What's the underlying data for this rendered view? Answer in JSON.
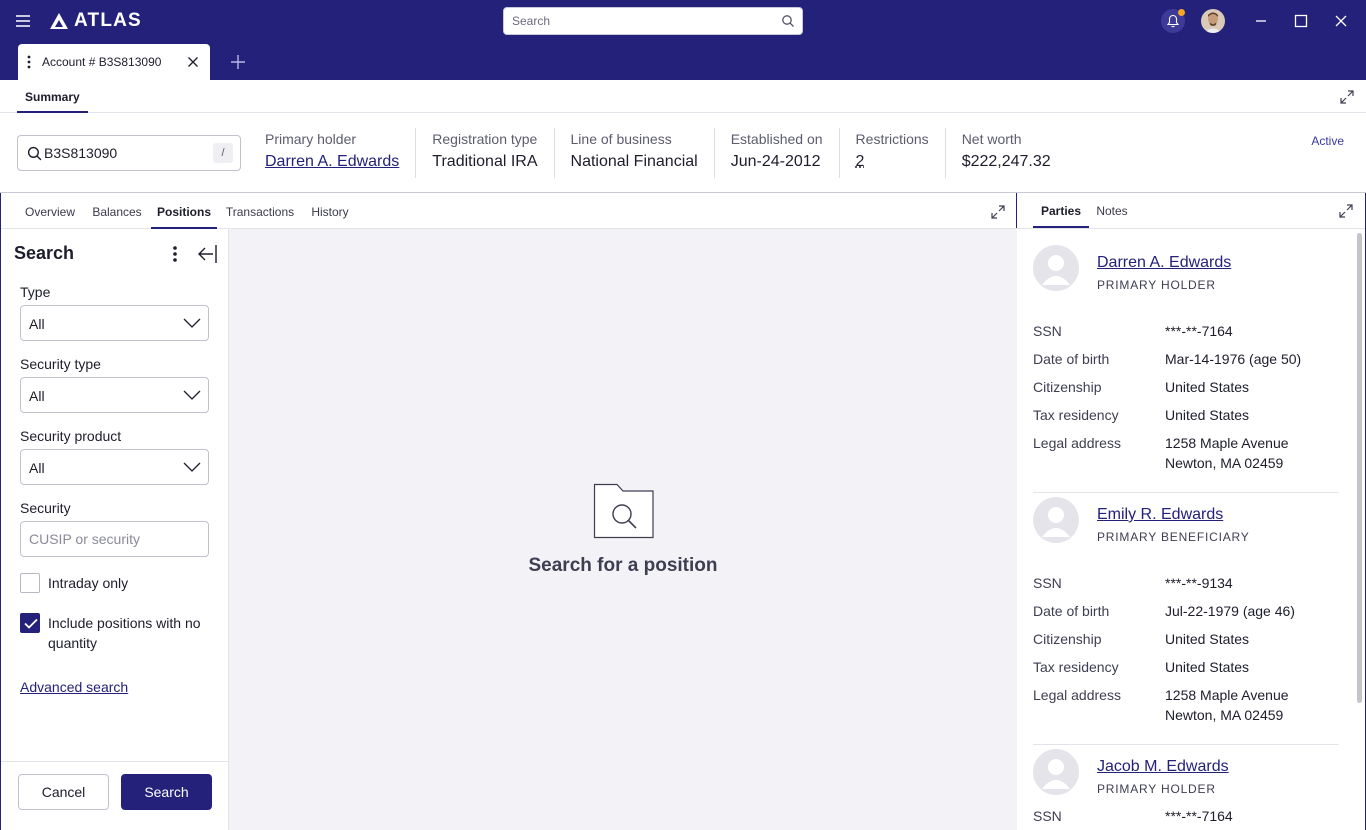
{
  "app": {
    "name": "ATLAS"
  },
  "global_search": {
    "placeholder": "Search"
  },
  "doc_tabs": [
    {
      "label": "Account # B3S813090"
    }
  ],
  "summary_tab": {
    "label": "Summary"
  },
  "account_search": {
    "value": "B3S813090",
    "shortcut": "/"
  },
  "account_fields": [
    {
      "label": "Primary holder",
      "value": "Darren A. Edwards"
    },
    {
      "label": "Registration type",
      "value": "Traditional IRA"
    },
    {
      "label": "Line of business",
      "value": "National Financial"
    },
    {
      "label": "Established on",
      "value": "Jun-24-2012"
    },
    {
      "label": "Restrictions",
      "value": "2"
    },
    {
      "label": "Net worth",
      "value": "$222,247.32"
    }
  ],
  "status": "Active",
  "sub_tabs": [
    "Overview",
    "Balances",
    "Positions",
    "Transactions",
    "History"
  ],
  "active_sub_tab": "Positions",
  "search_panel": {
    "title": "Search",
    "type": {
      "label": "Type",
      "value": "All"
    },
    "security_type": {
      "label": "Security type",
      "value": "All"
    },
    "security_product": {
      "label": "Security product",
      "value": "All"
    },
    "security": {
      "label": "Security",
      "placeholder": "CUSIP or security"
    },
    "intraday": {
      "label": "Intraday only",
      "checked": false
    },
    "include_zero": {
      "label": "Include positions with no quantity",
      "checked": true
    },
    "advanced_link": "Advanced search",
    "cancel_label": "Cancel",
    "search_label": "Search"
  },
  "empty_state": {
    "title": "Search for a position"
  },
  "right_tabs": [
    "Parties",
    "Notes"
  ],
  "party_labels": {
    "ssn": "SSN",
    "dob": "Date of birth",
    "citizenship": "Citizenship",
    "tax": "Tax residency",
    "address": "Legal address"
  },
  "parties": [
    {
      "name": "Darren A. Edwards",
      "role": "PRIMARY HOLDER",
      "ssn": "***-**-7164",
      "dob": "Mar-14-1976 (age 50)",
      "citizenship": "United States",
      "tax": "United States",
      "address1": "1258 Maple Avenue",
      "address2": "Newton, MA 02459"
    },
    {
      "name": "Emily R. Edwards",
      "role": "PRIMARY BENEFICIARY",
      "ssn": "***-**-9134",
      "dob": "Jul-22-1979 (age 46)",
      "citizenship": "United States",
      "tax": "United States",
      "address1": "1258 Maple Avenue",
      "address2": "Newton, MA 02459"
    },
    {
      "name": "Jacob M. Edwards",
      "role": "PRIMARY HOLDER",
      "ssn": "***-**-7164"
    }
  ],
  "colors": {
    "brand": "#23217a",
    "accent_dot": "#f5a623",
    "surface": "#f3f3f7"
  }
}
